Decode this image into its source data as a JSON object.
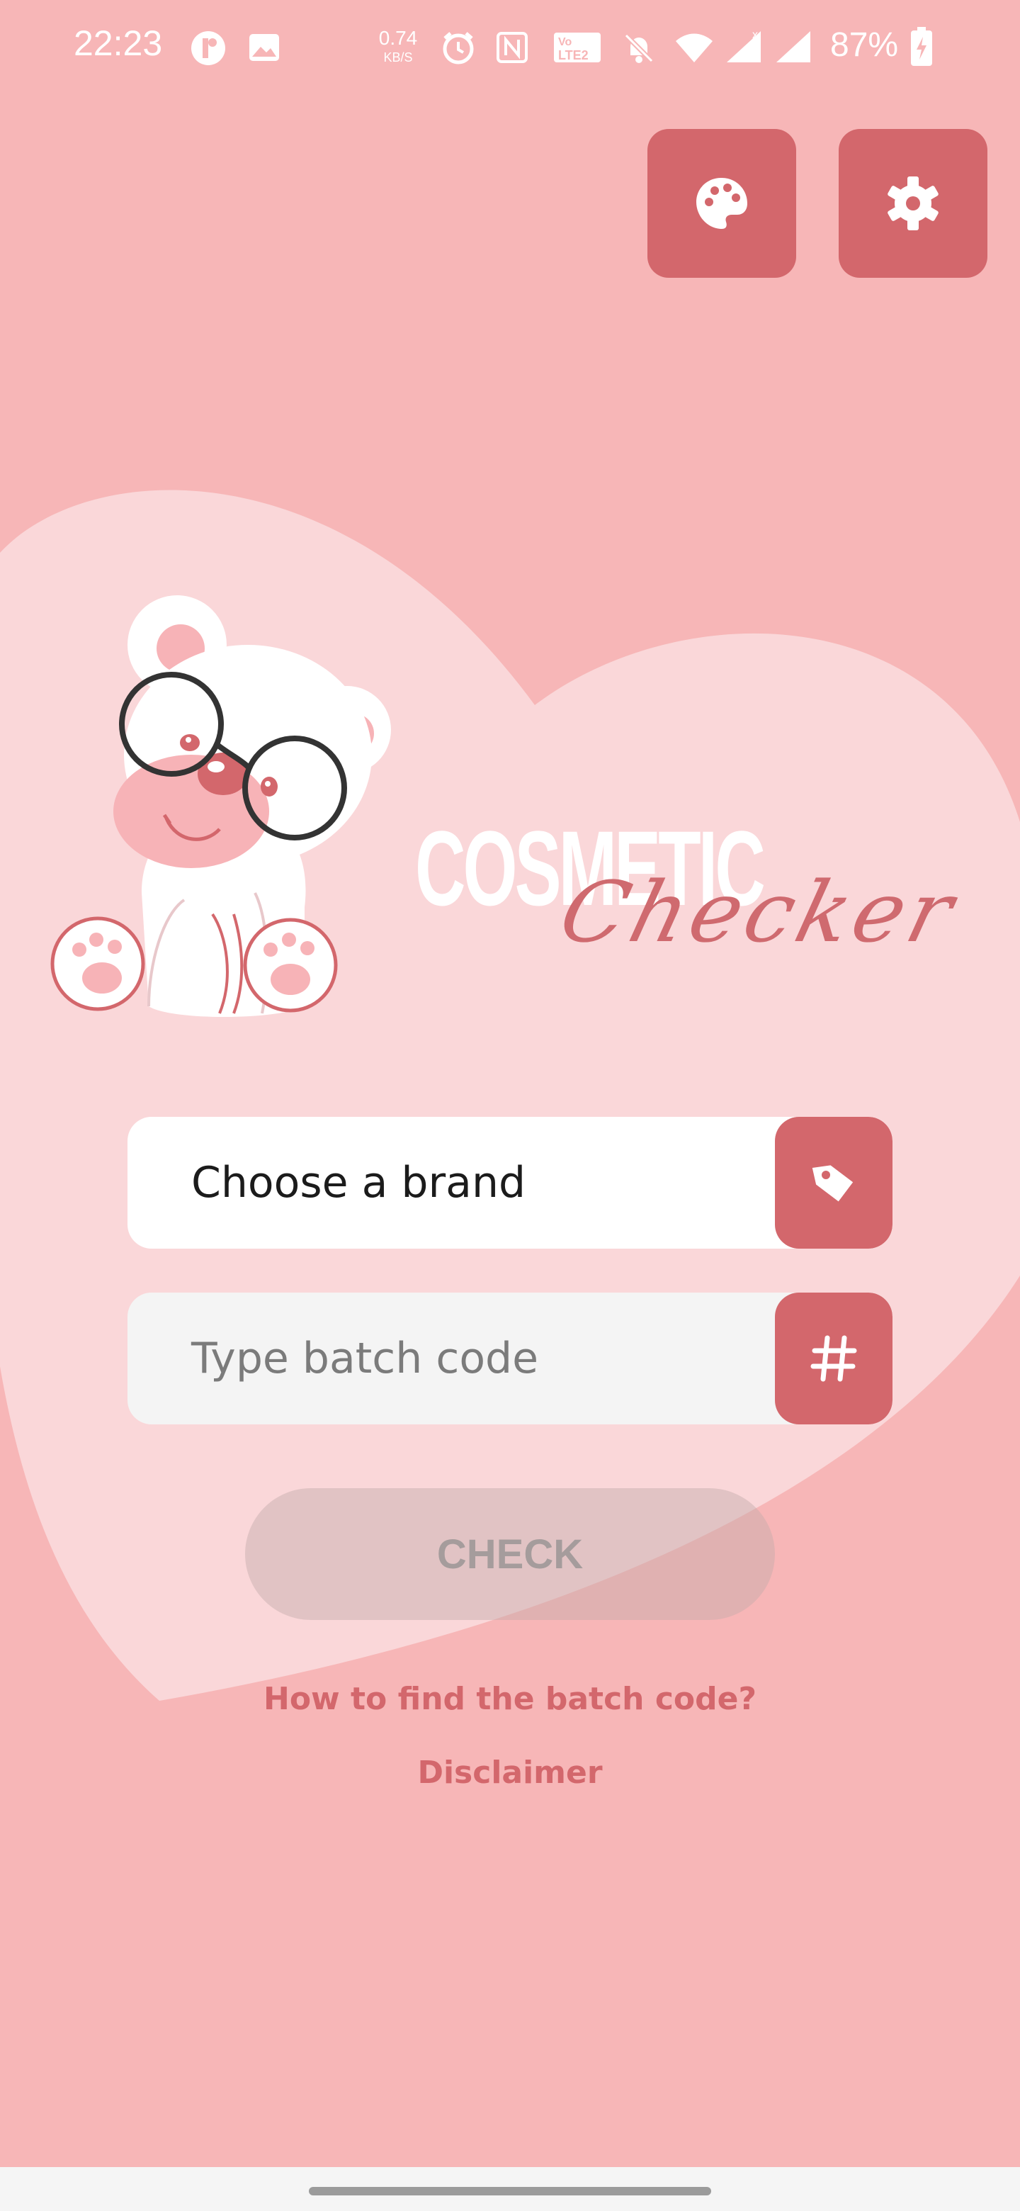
{
  "status_bar": {
    "time": "22:23",
    "net_speed_value": "0.74",
    "net_speed_unit": "KB/S",
    "battery_percent": "87%"
  },
  "logo": {
    "title": "COSMETIC",
    "script": "Checker"
  },
  "toolbar": {
    "theme_icon": "palette-icon",
    "settings_icon": "gear-icon"
  },
  "form": {
    "brand_value": "Choose a brand",
    "brand_icon": "tag-icon",
    "batch_placeholder": "Type batch code",
    "batch_icon": "hash-icon",
    "check_label": "CHECK"
  },
  "links": {
    "batch_help": "How to find the batch code?",
    "disclaimer": "Disclaimer"
  },
  "colors": {
    "background": "#f7b6b7",
    "accent": "#d3676c",
    "heart": "#fadadb"
  }
}
